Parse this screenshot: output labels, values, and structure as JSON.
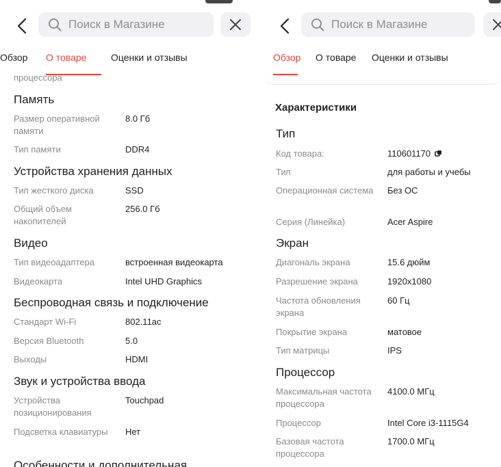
{
  "search": {
    "placeholder": "Поиск в Магазине"
  },
  "tabs": [
    "Обзор",
    "О товаре",
    "Оценки и отзывы"
  ],
  "colors": {
    "accent": "#e8433b",
    "label": "#8a8a8a",
    "value": "#222222",
    "search_bg": "#f1f1f3"
  },
  "icons": {
    "back": "chevron-left-icon",
    "search": "search-icon",
    "close": "close-icon",
    "copy": "copy-icon"
  },
  "left": {
    "active_tab": "О товаре",
    "top_clip": "процессора",
    "sections": [
      {
        "title": "Память",
        "rows": [
          {
            "label": "Размер оперативной памяти",
            "value": "8.0 Гб"
          },
          {
            "label": "Тип памяти",
            "value": "DDR4"
          }
        ]
      },
      {
        "title": "Устройства хранения данных",
        "rows": [
          {
            "label": "Тип жесткого диска",
            "value": "SSD"
          },
          {
            "label": "Общий объем накопителей",
            "value": "256.0 Гб"
          }
        ]
      },
      {
        "title": "Видео",
        "rows": [
          {
            "label": "Тип видеоадаптера",
            "value": "встроенная видеокарта"
          },
          {
            "label": "Видеокарта",
            "value": "Intel UHD Graphics"
          }
        ]
      },
      {
        "title": "Беспроводная связь и подключение",
        "rows": [
          {
            "label": "Стандарт Wi-Fi",
            "value": "802.11ac"
          },
          {
            "label": "Версия Bluetooth",
            "value": "5.0"
          },
          {
            "label": "Выходы",
            "value": "HDMI"
          }
        ]
      },
      {
        "title": "Звук и устройства ввода",
        "rows": [
          {
            "label": "Устройства позиционирования",
            "value": "Touchpad"
          },
          {
            "label": "Подсветка клавиатуры",
            "value": "Нет"
          }
        ]
      },
      {
        "title": "Особенности и дополнительная",
        "rows": []
      }
    ]
  },
  "right": {
    "active_tab": "Обзор",
    "card_title": "Характеристики",
    "sections": [
      {
        "title": "Тип",
        "rows": [
          {
            "label": "Код товара:",
            "value": "110601170",
            "copy": true
          },
          {
            "label": "Тип",
            "value": "для работы и учебы"
          },
          {
            "label": "Операционная система",
            "value": "Без ОС"
          },
          {
            "label": "Серия (Линейка)",
            "value": "Acer Aspire"
          }
        ]
      },
      {
        "title": "Экран",
        "rows": [
          {
            "label": "Диагональ экрана",
            "value": "15.6 дюйм"
          },
          {
            "label": "Разрешение экрана",
            "value": "1920x1080"
          },
          {
            "label": "Частота обновления экрана",
            "value": "60 Гц"
          },
          {
            "label": "Покрытие экрана",
            "value": "матовое"
          },
          {
            "label": "Тип матрицы",
            "value": "IPS"
          }
        ]
      },
      {
        "title": "Процессор",
        "rows": [
          {
            "label": "Максимальная частота процессора",
            "value": "4100.0 МГц"
          },
          {
            "label": "Процессор",
            "value": "Intel Core i3-1115G4"
          },
          {
            "label": "Базовая частота процессора",
            "value": "1700.0 МГц"
          }
        ]
      }
    ]
  }
}
